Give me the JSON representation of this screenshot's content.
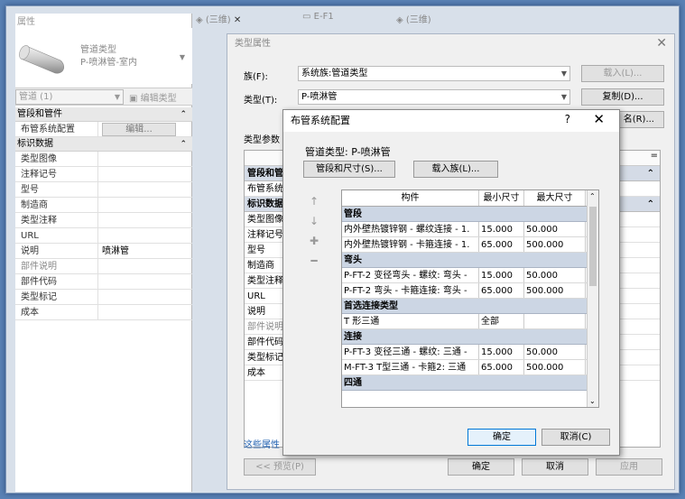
{
  "properties_panel": {
    "title": "属性",
    "type_name_line1": "管道类型",
    "type_name_line2": "P-喷淋管-室内",
    "instance_selector": "管道 (1)",
    "edit_type": "编辑类型",
    "sections": [
      {
        "title": "管段和管件",
        "rows": [
          {
            "key": "布管系统配置",
            "button": "编辑..."
          }
        ]
      },
      {
        "title": "标识数据",
        "rows": [
          {
            "key": "类型图像",
            "value": ""
          },
          {
            "key": "注释记号",
            "value": ""
          },
          {
            "key": "型号",
            "value": ""
          },
          {
            "key": "制造商",
            "value": ""
          },
          {
            "key": "类型注释",
            "value": ""
          },
          {
            "key": "URL",
            "value": ""
          },
          {
            "key": "说明",
            "value": "喷淋管"
          },
          {
            "key": "部件说明",
            "value": ""
          },
          {
            "key": "部件代码",
            "value": ""
          },
          {
            "key": "类型标记",
            "value": ""
          },
          {
            "key": "成本",
            "value": ""
          }
        ]
      }
    ]
  },
  "tabs": [
    "(三维)",
    "E-F1",
    "(三维)"
  ],
  "type_properties": {
    "title": "类型属性",
    "family_label": "族(F):",
    "family_value": "系统族:管道类型",
    "type_label": "类型(T):",
    "type_value": "P-喷淋管",
    "load_button": "载入(L)...",
    "duplicate_button": "复制(D)...",
    "rename_button": "名(R)...",
    "params_label": "类型参数",
    "grid_sections": [
      {
        "title": "管段和管",
        "rows": [
          "布管系统"
        ]
      },
      {
        "title": "标识数据",
        "rows": [
          "类型图像",
          "注释记号",
          "型号",
          "制造商",
          "类型注释",
          "URL",
          "说明",
          "部件说明",
          "部件代码",
          "类型标记",
          "成本"
        ]
      }
    ],
    "link": "这些属性",
    "preview_button": "<< 预览(P)",
    "ok_button": "确定",
    "cancel_button": "取消",
    "apply_button": "应用"
  },
  "routing_dialog": {
    "title": "布管系统配置",
    "help": "?",
    "pipe_type_label": "管道类型: P-喷淋管",
    "segments_button": "管段和尺寸(S)...",
    "load_family_button": "载入族(L)...",
    "columns": [
      "构件",
      "最小尺寸",
      "最大尺寸"
    ],
    "groups": [
      {
        "title": "管段",
        "rows": [
          {
            "part": "内外壁热镀锌钢 - 螺纹连接 - 1.",
            "min": "15.000",
            "max": "50.000"
          },
          {
            "part": "内外壁热镀锌钢 - 卡箍连接 - 1.",
            "min": "65.000",
            "max": "500.000"
          }
        ]
      },
      {
        "title": "弯头",
        "rows": [
          {
            "part": "P-FT-2 变径弯头 - 螺纹: 弯头 -",
            "min": "15.000",
            "max": "50.000"
          },
          {
            "part": "P-FT-2 弯头 - 卡箍连接: 弯头 -",
            "min": "65.000",
            "max": "500.000"
          }
        ]
      },
      {
        "title": "首选连接类型",
        "rows": [
          {
            "part": "T 形三通",
            "min": "全部",
            "max": ""
          }
        ]
      },
      {
        "title": "连接",
        "rows": [
          {
            "part": "P-FT-3 变径三通 - 螺纹: 三通 -",
            "min": "15.000",
            "max": "50.000"
          },
          {
            "part": "M-FT-3 T型三通 - 卡箍2: 三通",
            "min": "65.000",
            "max": "500.000"
          }
        ]
      },
      {
        "title": "四通",
        "rows": []
      }
    ],
    "ok_button": "确定",
    "cancel_button": "取消(C)"
  }
}
